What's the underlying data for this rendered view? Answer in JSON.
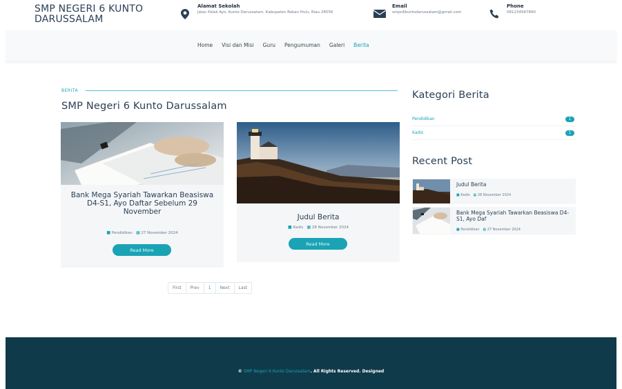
{
  "header": {
    "brand_line1": "SMP NEGERI 6 KUNTO",
    "brand_line2": "DARUSSALAM",
    "alamat": {
      "title": "Alamat Sekolah",
      "text": "Jalan Palak Ayo, Kunto Darussalam, Kabupaten Rokan Hulu, Riau 28556",
      "icon": "map-pin-icon"
    },
    "email": {
      "title": "Email",
      "text": "smpn6kuntodarussalam@gmail.com",
      "icon": "envelope-icon"
    },
    "phone": {
      "title": "Phone",
      "text": "081234567890",
      "icon": "phone-icon"
    }
  },
  "nav": {
    "items": [
      "Home",
      "Visi dan Misi",
      "Guru",
      "Pengumuman",
      "Galeri",
      "Berita"
    ],
    "active": "Berita"
  },
  "main": {
    "breadcrumb": "BERITA",
    "title": "SMP Negeri 6 Kunto Darussalam",
    "posts": [
      {
        "title": "Bank Mega Syariah Tawarkan Beasiswa D4-S1, Ayo Daftar Sebelum 29 November",
        "category": "Pendidikan",
        "date": "27 November 2024",
        "button": "Read More"
      },
      {
        "title": "Judul Berita",
        "category": "Kadis",
        "date": "28 November 2024",
        "button": "Read More"
      }
    ],
    "pagination": [
      "First",
      "Prev",
      "1",
      "Next",
      "Last"
    ]
  },
  "sidebar": {
    "categories_title": "Kategori Berita",
    "categories": [
      {
        "label": "Pendidikan",
        "count": "1"
      },
      {
        "label": "Kadis",
        "count": "1"
      }
    ],
    "recent_title": "Recent Post",
    "recent": [
      {
        "title": "Judul Berita",
        "category": "Kadis",
        "date": "28 November 2024"
      },
      {
        "title": "Bank Mega Syariah Tawarkan Beasiswa D4-S1, Ayo Daf",
        "category": "Pendidikan",
        "date": "27 November 2024"
      }
    ]
  },
  "footer": {
    "copy_symbol": "©",
    "site": "SMP Negeri 6 Kunto Darussalam",
    "rights": ". All Rights Reserved. Designed"
  },
  "colors": {
    "accent": "#17a2b8",
    "footer_bg": "#0f3a4a",
    "heading": "#2a3f54"
  }
}
